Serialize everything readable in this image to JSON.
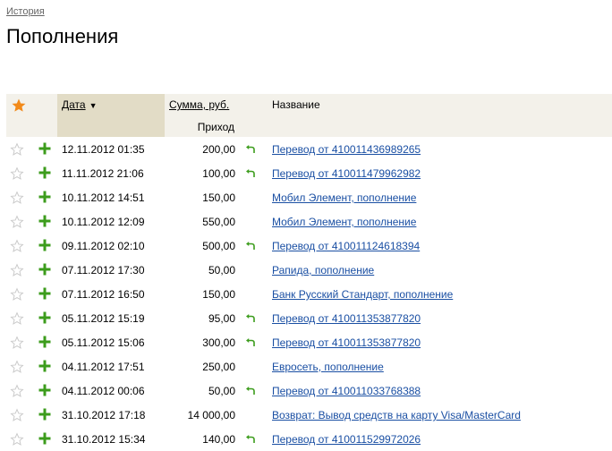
{
  "breadcrumb": "История",
  "title": "Пополнения",
  "table": {
    "header": {
      "date": "Дата",
      "date_sort_arrow": "▼",
      "sum": "Сумма, руб.",
      "income": "Приход",
      "name": "Название"
    },
    "rows": [
      {
        "date": "12.11.2012 01:35",
        "amount": "200,00",
        "has_return": true,
        "name": "Перевод от 410011436989265"
      },
      {
        "date": "11.11.2012 21:06",
        "amount": "100,00",
        "has_return": true,
        "name": "Перевод от 410011479962982"
      },
      {
        "date": "10.11.2012 14:51",
        "amount": "150,00",
        "has_return": false,
        "name": "Мобил Элемент, пополнение"
      },
      {
        "date": "10.11.2012 12:09",
        "amount": "550,00",
        "has_return": false,
        "name": "Мобил Элемент, пополнение"
      },
      {
        "date": "09.11.2012 02:10",
        "amount": "500,00",
        "has_return": true,
        "name": "Перевод от 410011124618394"
      },
      {
        "date": "07.11.2012 17:30",
        "amount": "50,00",
        "has_return": false,
        "name": "Рапида, пополнение"
      },
      {
        "date": "07.11.2012 16:50",
        "amount": "150,00",
        "has_return": false,
        "name": "Банк Русский Стандарт, пополнение"
      },
      {
        "date": "05.11.2012 15:19",
        "amount": "95,00",
        "has_return": true,
        "name": "Перевод от 410011353877820"
      },
      {
        "date": "05.11.2012 15:06",
        "amount": "300,00",
        "has_return": true,
        "name": "Перевод от 410011353877820"
      },
      {
        "date": "04.11.2012 17:51",
        "amount": "250,00",
        "has_return": false,
        "name": "Евросеть, пополнение"
      },
      {
        "date": "04.11.2012 00:06",
        "amount": "50,00",
        "has_return": true,
        "name": "Перевод от 410011033768388"
      },
      {
        "date": "31.10.2012 17:18",
        "amount": "14 000,00",
        "has_return": false,
        "name": "Возврат: Вывод средств на карту Visa/MasterCard"
      },
      {
        "date": "31.10.2012 15:34",
        "amount": "140,00",
        "has_return": true,
        "name": "Перевод от 410011529972026"
      }
    ]
  },
  "colors": {
    "header_bg": "#f3f1ea",
    "sorted_col_bg": "#e2dcc6",
    "link": "#1a4fa3",
    "plus": "#3c9c1c",
    "star_active": "#f28a1a",
    "star_inactive": "#c8c8c8"
  },
  "icons": {
    "header_star": "star-filled-icon",
    "row_star": "star-outline-icon",
    "income": "plus-icon",
    "return": "return-arrow-icon"
  }
}
